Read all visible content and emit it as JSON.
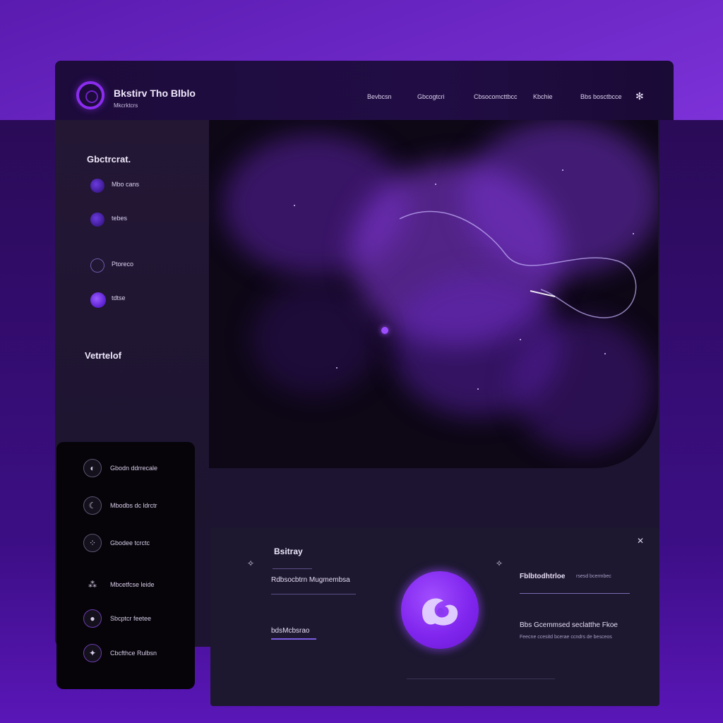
{
  "app": {
    "title": "Bkstirv Tho Blblo",
    "subtitle": "Mkcrktcrs"
  },
  "nav": {
    "items": [
      "Bevbcsn",
      "Gbcogtcri",
      "Cbsocomcttbcc",
      "Kbchie",
      "Bbs bosctbcce"
    ],
    "settings_icon": "gear-icon"
  },
  "sidebar": {
    "section1_title": "Gbctrcrat.",
    "items": [
      {
        "label": "Mbo cans",
        "icon": "dot-icon"
      },
      {
        "label": "tebes",
        "icon": "dot-icon"
      },
      {
        "label": "Ptoreco",
        "icon": "ring-icon"
      },
      {
        "label": "tdtse",
        "icon": "dot-icon"
      }
    ],
    "section2_title": "Vetrtelof"
  },
  "list": {
    "items": [
      {
        "label": "Gbodn ddrrecale",
        "icon": "orbit-icon"
      },
      {
        "label": "Mbodbs dc ldrctr",
        "icon": "moon-icon"
      },
      {
        "label": "Gbodee tcrctc",
        "icon": "dots-cluster-icon"
      },
      {
        "label": "Mbcetfcse leide",
        "icon": "sparkle-cluster-icon"
      },
      {
        "label": "Sbcptcr feetee",
        "icon": "planet-icon"
      },
      {
        "label": "Cbcfthce Rulbsn",
        "icon": "star-icon"
      }
    ]
  },
  "card": {
    "title": "Bsitray",
    "field1_label": "Rdbsocbtrn Mugmembsa",
    "field2_label": "bdsMcbsrao",
    "right_label": "Fblbtodhtrloe",
    "right_hint": "rsesd bcermbec",
    "right_text": "Bbs Gcemmsed seclatthe Fkoe",
    "right_small": "Feecne ccesitd bcerae ccndrs de besceos"
  },
  "colors": {
    "accent": "#8b2cf0",
    "orb": "#8026ee",
    "panel": "#1d1830",
    "background_top": "#8a3be8"
  }
}
